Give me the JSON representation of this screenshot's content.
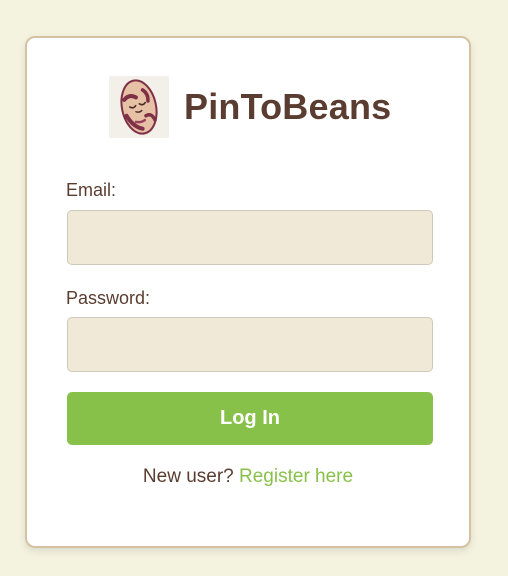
{
  "brand": {
    "name": "PinToBeans",
    "logo_icon": "bean-mascot-icon"
  },
  "form": {
    "email_label": "Email:",
    "email_value": "",
    "email_placeholder": "",
    "password_label": "Password:",
    "password_value": "",
    "password_placeholder": "",
    "submit_label": "Log In"
  },
  "footer": {
    "prompt": "New user?",
    "register_link": "Register here"
  },
  "colors": {
    "page_background": "#f4f3df",
    "card_background": "#ffffff",
    "card_border": "#d5c2a3",
    "brand_text": "#5a3d30",
    "input_background": "#f1e9d7",
    "accent_green": "#88c14a"
  }
}
